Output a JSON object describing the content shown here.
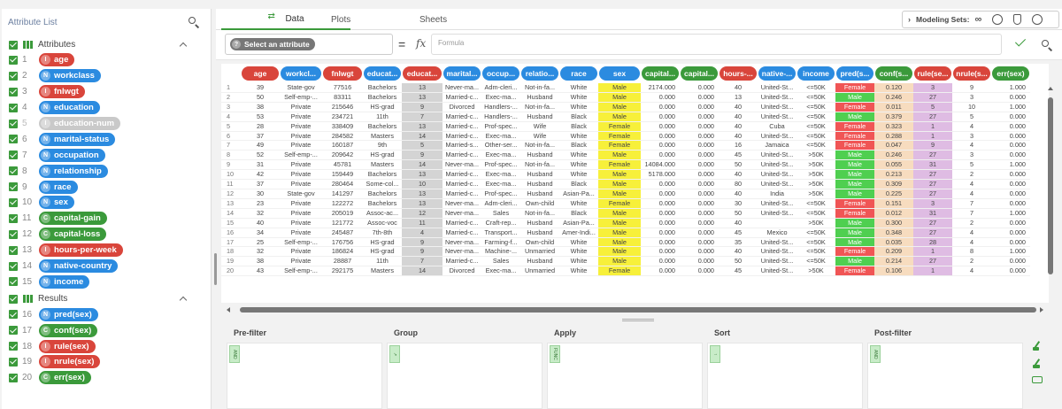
{
  "sidebar": {
    "title": "Attribute List",
    "groups": [
      {
        "label": "Attributes"
      },
      {
        "label": "Results"
      }
    ],
    "attributes": [
      {
        "n": "1",
        "name": "age",
        "type": "I",
        "color": "red"
      },
      {
        "n": "2",
        "name": "workclass",
        "type": "N",
        "color": "blue"
      },
      {
        "n": "3",
        "name": "fnlwgt",
        "type": "I",
        "color": "red"
      },
      {
        "n": "4",
        "name": "education",
        "type": "N",
        "color": "blue"
      },
      {
        "n": "5",
        "name": "education-num",
        "type": "I",
        "color": "grey"
      },
      {
        "n": "6",
        "name": "marital-status",
        "type": "N",
        "color": "blue"
      },
      {
        "n": "7",
        "name": "occupation",
        "type": "N",
        "color": "blue"
      },
      {
        "n": "8",
        "name": "relationship",
        "type": "N",
        "color": "blue"
      },
      {
        "n": "9",
        "name": "race",
        "type": "N",
        "color": "blue"
      },
      {
        "n": "10",
        "name": "sex",
        "type": "N",
        "color": "blue"
      },
      {
        "n": "11",
        "name": "capital-gain",
        "type": "C",
        "color": "green"
      },
      {
        "n": "12",
        "name": "capital-loss",
        "type": "C",
        "color": "green"
      },
      {
        "n": "13",
        "name": "hours-per-week",
        "type": "I",
        "color": "red"
      },
      {
        "n": "14",
        "name": "native-country",
        "type": "N",
        "color": "blue"
      },
      {
        "n": "15",
        "name": "income",
        "type": "N",
        "color": "blue"
      }
    ],
    "results": [
      {
        "n": "16",
        "name": "pred(sex)",
        "type": "N",
        "color": "blue"
      },
      {
        "n": "17",
        "name": "conf(sex)",
        "type": "C",
        "color": "green"
      },
      {
        "n": "18",
        "name": "rule(sex)",
        "type": "I",
        "color": "red"
      },
      {
        "n": "19",
        "name": "nrule(sex)",
        "type": "I",
        "color": "red"
      },
      {
        "n": "20",
        "name": "err(sex)",
        "type": "C",
        "color": "green"
      }
    ]
  },
  "tabs": {
    "data": "Data",
    "plots": "Plots",
    "sheets": "Sheets"
  },
  "modeling": {
    "label": "Modeling Sets:"
  },
  "formula": {
    "select_label": "Select an attribute",
    "eq": "=",
    "fx": "fx",
    "placeholder": "Formula"
  },
  "table": {
    "columns": [
      {
        "label": "age",
        "color": "#d9453b"
      },
      {
        "label": "workcl...",
        "color": "#2b8be0"
      },
      {
        "label": "fnlwgt",
        "color": "#d9453b"
      },
      {
        "label": "educat...",
        "color": "#2b8be0"
      },
      {
        "label": "educat...",
        "color": "#d9453b"
      },
      {
        "label": "marital...",
        "color": "#2b8be0"
      },
      {
        "label": "occup...",
        "color": "#2b8be0"
      },
      {
        "label": "relatio...",
        "color": "#2b8be0"
      },
      {
        "label": "race",
        "color": "#2b8be0"
      },
      {
        "label": "sex",
        "color": "#2b8be0"
      },
      {
        "label": "capital...",
        "color": "#3b9a3b"
      },
      {
        "label": "capital...",
        "color": "#3b9a3b"
      },
      {
        "label": "hours-...",
        "color": "#d9453b"
      },
      {
        "label": "native-...",
        "color": "#2b8be0"
      },
      {
        "label": "income",
        "color": "#2b8be0"
      },
      {
        "label": "pred(s...",
        "color": "#2b8be0"
      },
      {
        "label": "conf(s...",
        "color": "#3b9a3b"
      },
      {
        "label": "rule(se...",
        "color": "#d9453b"
      },
      {
        "label": "nrule(s...",
        "color": "#d9453b"
      },
      {
        "label": "err(sex)",
        "color": "#3b9a3b"
      }
    ],
    "rows": [
      [
        "1",
        "39",
        "State-gov",
        "77516",
        "Bachelors",
        "13",
        "Never-ma...",
        "Adm-cleri...",
        "Not-in-fa...",
        "White",
        "Male",
        "2174.000",
        "0.000",
        "40",
        "United-St...",
        "<=50K",
        "Female",
        "0.120",
        "3",
        "9",
        "1.000"
      ],
      [
        "2",
        "50",
        "Self-emp-...",
        "83311",
        "Bachelors",
        "13",
        "Married-c...",
        "Exec-ma...",
        "Husband",
        "White",
        "Male",
        "0.000",
        "0.000",
        "13",
        "United-St...",
        "<=50K",
        "Male",
        "0.246",
        "27",
        "3",
        "0.000"
      ],
      [
        "3",
        "38",
        "Private",
        "215646",
        "HS-grad",
        "9",
        "Divorced",
        "Handlers-...",
        "Not-in-fa...",
        "White",
        "Male",
        "0.000",
        "0.000",
        "40",
        "United-St...",
        "<=50K",
        "Female",
        "0.011",
        "5",
        "10",
        "1.000"
      ],
      [
        "4",
        "53",
        "Private",
        "234721",
        "11th",
        "7",
        "Married-c...",
        "Handlers-...",
        "Husband",
        "Black",
        "Male",
        "0.000",
        "0.000",
        "40",
        "United-St...",
        "<=50K",
        "Male",
        "0.379",
        "27",
        "5",
        "0.000"
      ],
      [
        "5",
        "28",
        "Private",
        "338409",
        "Bachelors",
        "13",
        "Married-c...",
        "Prof-spec...",
        "Wife",
        "Black",
        "Female",
        "0.000",
        "0.000",
        "40",
        "Cuba",
        "<=50K",
        "Female",
        "0.323",
        "1",
        "4",
        "0.000"
      ],
      [
        "6",
        "37",
        "Private",
        "284582",
        "Masters",
        "14",
        "Married-c...",
        "Exec-ma...",
        "Wife",
        "White",
        "Female",
        "0.000",
        "0.000",
        "40",
        "United-St...",
        "<=50K",
        "Female",
        "0.288",
        "1",
        "3",
        "0.000"
      ],
      [
        "7",
        "49",
        "Private",
        "160187",
        "9th",
        "5",
        "Married-s...",
        "Other-ser...",
        "Not-in-fa...",
        "Black",
        "Female",
        "0.000",
        "0.000",
        "16",
        "Jamaica",
        "<=50K",
        "Female",
        "0.047",
        "9",
        "4",
        "0.000"
      ],
      [
        "8",
        "52",
        "Self-emp-...",
        "209642",
        "HS-grad",
        "9",
        "Married-c...",
        "Exec-ma...",
        "Husband",
        "White",
        "Male",
        "0.000",
        "0.000",
        "45",
        "United-St...",
        ">50K",
        "Male",
        "0.246",
        "27",
        "3",
        "0.000"
      ],
      [
        "9",
        "31",
        "Private",
        "45781",
        "Masters",
        "14",
        "Never-ma...",
        "Prof-spec...",
        "Not-in-fa...",
        "White",
        "Female",
        "14084.000",
        "0.000",
        "50",
        "United-St...",
        ">50K",
        "Male",
        "0.055",
        "31",
        "5",
        "1.000"
      ],
      [
        "10",
        "42",
        "Private",
        "159449",
        "Bachelors",
        "13",
        "Married-c...",
        "Exec-ma...",
        "Husband",
        "White",
        "Male",
        "5178.000",
        "0.000",
        "40",
        "United-St...",
        ">50K",
        "Male",
        "0.213",
        "27",
        "2",
        "0.000"
      ],
      [
        "11",
        "37",
        "Private",
        "280464",
        "Some-col...",
        "10",
        "Married-c...",
        "Exec-ma...",
        "Husband",
        "Black",
        "Male",
        "0.000",
        "0.000",
        "80",
        "United-St...",
        ">50K",
        "Male",
        "0.309",
        "27",
        "4",
        "0.000"
      ],
      [
        "12",
        "30",
        "State-gov",
        "141297",
        "Bachelors",
        "13",
        "Married-c...",
        "Prof-spec...",
        "Husband",
        "Asian-Pa...",
        "Male",
        "0.000",
        "0.000",
        "40",
        "India",
        ">50K",
        "Male",
        "0.225",
        "27",
        "4",
        "0.000"
      ],
      [
        "13",
        "23",
        "Private",
        "122272",
        "Bachelors",
        "13",
        "Never-ma...",
        "Adm-cleri...",
        "Own-child",
        "White",
        "Female",
        "0.000",
        "0.000",
        "30",
        "United-St...",
        "<=50K",
        "Female",
        "0.151",
        "3",
        "7",
        "0.000"
      ],
      [
        "14",
        "32",
        "Private",
        "205019",
        "Assoc-ac...",
        "12",
        "Never-ma...",
        "Sales",
        "Not-in-fa...",
        "Black",
        "Male",
        "0.000",
        "0.000",
        "50",
        "United-St...",
        "<=50K",
        "Female",
        "0.012",
        "31",
        "7",
        "1.000"
      ],
      [
        "15",
        "40",
        "Private",
        "121772",
        "Assoc-voc",
        "11",
        "Married-c...",
        "Craft-rep...",
        "Husband",
        "Asian-Pa...",
        "Male",
        "0.000",
        "0.000",
        "40",
        "",
        ">50K",
        "Male",
        "0.300",
        "27",
        "2",
        "0.000"
      ],
      [
        "16",
        "34",
        "Private",
        "245487",
        "7th-8th",
        "4",
        "Married-c...",
        "Transport...",
        "Husband",
        "Amer-Indi...",
        "Male",
        "0.000",
        "0.000",
        "45",
        "Mexico",
        "<=50K",
        "Male",
        "0.348",
        "27",
        "4",
        "0.000"
      ],
      [
        "17",
        "25",
        "Self-emp-...",
        "176756",
        "HS-grad",
        "9",
        "Never-ma...",
        "Farming-f...",
        "Own-child",
        "White",
        "Male",
        "0.000",
        "0.000",
        "35",
        "United-St...",
        "<=50K",
        "Male",
        "0.035",
        "28",
        "4",
        "0.000"
      ],
      [
        "18",
        "32",
        "Private",
        "186824",
        "HS-grad",
        "9",
        "Never-ma...",
        "Machine-...",
        "Unmarried",
        "White",
        "Male",
        "0.000",
        "0.000",
        "40",
        "United-St...",
        "<=50K",
        "Female",
        "0.209",
        "1",
        "8",
        "1.000"
      ],
      [
        "19",
        "38",
        "Private",
        "28887",
        "11th",
        "7",
        "Married-c...",
        "Sales",
        "Husband",
        "White",
        "Male",
        "0.000",
        "0.000",
        "50",
        "United-St...",
        "<=50K",
        "Male",
        "0.214",
        "27",
        "2",
        "0.000"
      ],
      [
        "20",
        "43",
        "Self-emp-...",
        "292175",
        "Masters",
        "14",
        "Divorced",
        "Exec-ma...",
        "Unmarried",
        "White",
        "Female",
        "0.000",
        "0.000",
        "45",
        "United-St...",
        ">50K",
        "Female",
        "0.106",
        "1",
        "4",
        "0.000"
      ]
    ]
  },
  "pipeline": {
    "stages": [
      {
        "title": "Pre-filter",
        "tag": "AND"
      },
      {
        "title": "Group",
        "tag": "↗"
      },
      {
        "title": "Apply",
        "tag": "FUNC"
      },
      {
        "title": "Sort",
        "tag": "↑"
      },
      {
        "title": "Post-filter",
        "tag": "AND"
      }
    ]
  }
}
